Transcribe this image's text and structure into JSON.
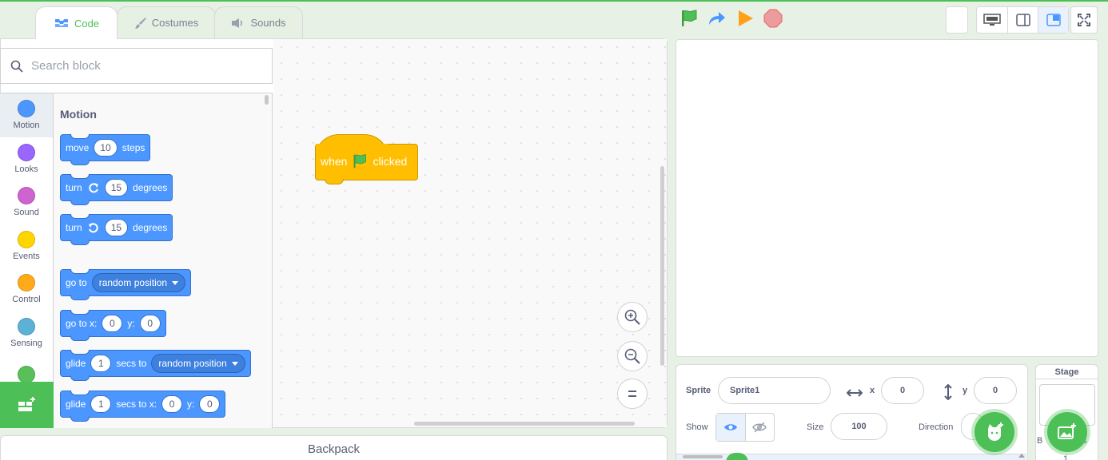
{
  "tabs": [
    {
      "label": "Code",
      "active": true,
      "icon": "code-icon"
    },
    {
      "label": "Costumes",
      "active": false,
      "icon": "brush-icon"
    },
    {
      "label": "Sounds",
      "active": false,
      "icon": "speaker-icon"
    }
  ],
  "controls": {
    "green_flag": "green-flag-icon",
    "turbo": "turbo-arrow-icon",
    "run": "run-triangle-icon",
    "stop": "stop-octagon-icon"
  },
  "search": {
    "placeholder": "Search block"
  },
  "categories": [
    {
      "label": "Motion",
      "color": "#4c97ff",
      "selected": true
    },
    {
      "label": "Looks",
      "color": "#9966ff",
      "selected": false
    },
    {
      "label": "Sound",
      "color": "#cf63cf",
      "selected": false
    },
    {
      "label": "Events",
      "color": "#ffd500",
      "selected": false
    },
    {
      "label": "Control",
      "color": "#ffab19",
      "selected": false
    },
    {
      "label": "Sensing",
      "color": "#5cb1d6",
      "selected": false
    },
    {
      "label": "",
      "color": "#59c059",
      "selected": false
    }
  ],
  "palette": {
    "title": "Motion",
    "move": {
      "label": "move",
      "value": "10",
      "suffix": "steps"
    },
    "turn_right": {
      "label": "turn",
      "value": "15",
      "suffix": "degrees"
    },
    "turn_left": {
      "label": "turn",
      "value": "15",
      "suffix": "degrees"
    },
    "goto": {
      "label": "go to",
      "option": "random position"
    },
    "goto_xy": {
      "label": "go to x:",
      "x": "0",
      "y_label": "y:",
      "y": "0"
    },
    "glide": {
      "label": "glide",
      "value": "1",
      "mid": "secs to",
      "option": "random position"
    },
    "glide_xy": {
      "label": "glide",
      "value": "1",
      "mid": "secs to x:",
      "x": "0",
      "y_label": "y:",
      "y": "0"
    }
  },
  "script": {
    "when": "when",
    "clicked": "clicked"
  },
  "backpack": {
    "label": "Backpack"
  },
  "sprite_info": {
    "sprite_label": "Sprite",
    "sprite_name": "Sprite1",
    "x_label": "x",
    "x": "0",
    "y_label": "y",
    "y": "0",
    "show_label": "Show",
    "size_label": "Size",
    "size": "100",
    "direction_label": "Direction"
  },
  "stage_selector": {
    "title": "Stage",
    "backdrops_partial": "B",
    "backdrops_partial2": "s",
    "count": "1"
  }
}
